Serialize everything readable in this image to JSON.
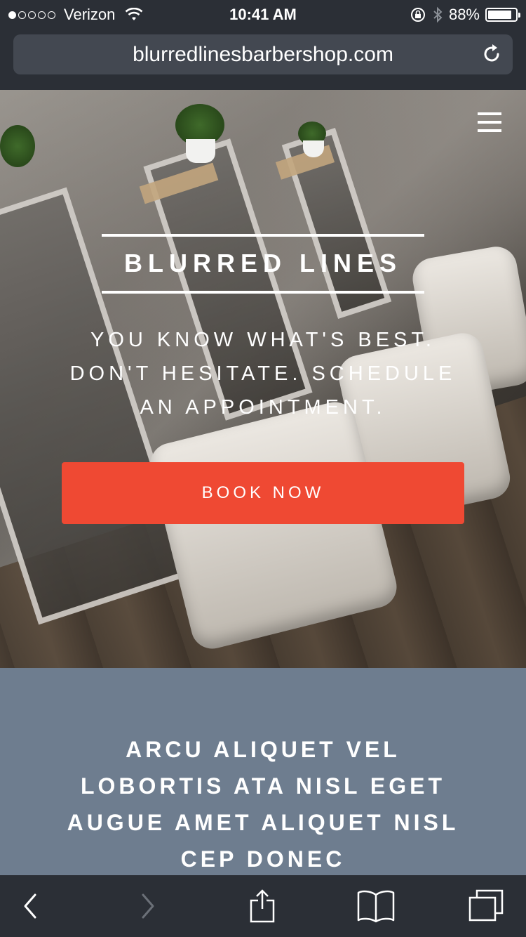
{
  "status_bar": {
    "carrier": "Verizon",
    "time": "10:41 AM",
    "battery": "88%",
    "signal_bars_filled": 1,
    "signal_bars_total": 5,
    "battery_level": 0.88
  },
  "browser": {
    "url": "blurredlinesbarbershop.com"
  },
  "hero": {
    "brand": "BLURRED LINES",
    "tagline_lines": [
      "YOU KNOW WHAT'S BEST.",
      "DON'T HESITATE. SCHEDULE",
      "AN APPOINTMENT."
    ],
    "cta": "BOOK NOW"
  },
  "section": {
    "heading_lines": [
      "ARCU ALIQUET VEL",
      "LOBORTIS ATA NISL EGET",
      "AUGUE AMET ALIQUET NISL",
      "CEP DONEC"
    ]
  },
  "colors": {
    "accent": "#ef4933",
    "section_bg": "#6e7d8f",
    "chrome": "#2b2f36"
  },
  "icons": {
    "menu": "hamburger-icon",
    "reload": "reload-icon",
    "back": "chevron-left-icon",
    "forward": "chevron-right-icon",
    "share": "share-icon",
    "bookmarks": "book-icon",
    "tabs": "tabs-icon"
  }
}
